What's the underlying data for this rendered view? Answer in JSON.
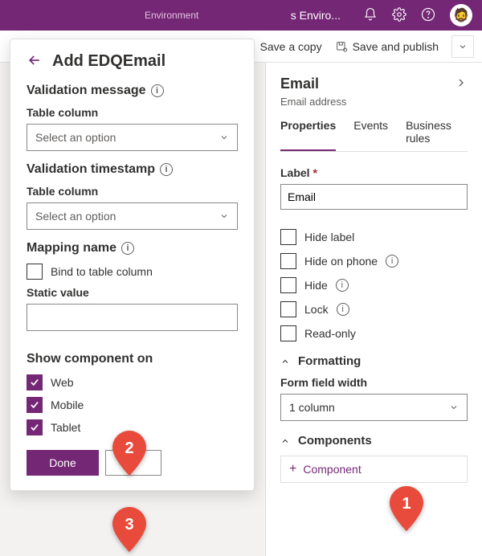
{
  "topbar": {
    "env_section_label": "Environment",
    "env_name": "s Enviro..."
  },
  "cmdbar": {
    "save_copy": "Save a copy",
    "save_publish": "Save and publish"
  },
  "leftPanel": {
    "title": "Add EDQEmail",
    "validation_message": "Validation message",
    "table_column": "Table column",
    "select_placeholder": "Select an option",
    "validation_timestamp": "Validation timestamp",
    "mapping_name": "Mapping name",
    "bind_to_table": "Bind to table column",
    "static_value": "Static value",
    "show_component_on": "Show component on",
    "platforms": {
      "web": "Web",
      "mobile": "Mobile",
      "tablet": "Tablet"
    },
    "done": "Done"
  },
  "rightPane": {
    "title": "Email",
    "subtitle": "Email address",
    "tabs": {
      "properties": "Properties",
      "events": "Events",
      "business_rules": "Business rules"
    },
    "label_field": "Label",
    "label_value": "Email",
    "options": {
      "hide_label": "Hide label",
      "hide_on_phone": "Hide on phone",
      "hide": "Hide",
      "lock": "Lock",
      "read_only": "Read-only"
    },
    "formatting": "Formatting",
    "form_field_width": "Form field width",
    "width_value": "1 column",
    "components": "Components",
    "add_component": "Component"
  },
  "callouts": {
    "one": "1",
    "two": "2",
    "three": "3"
  }
}
